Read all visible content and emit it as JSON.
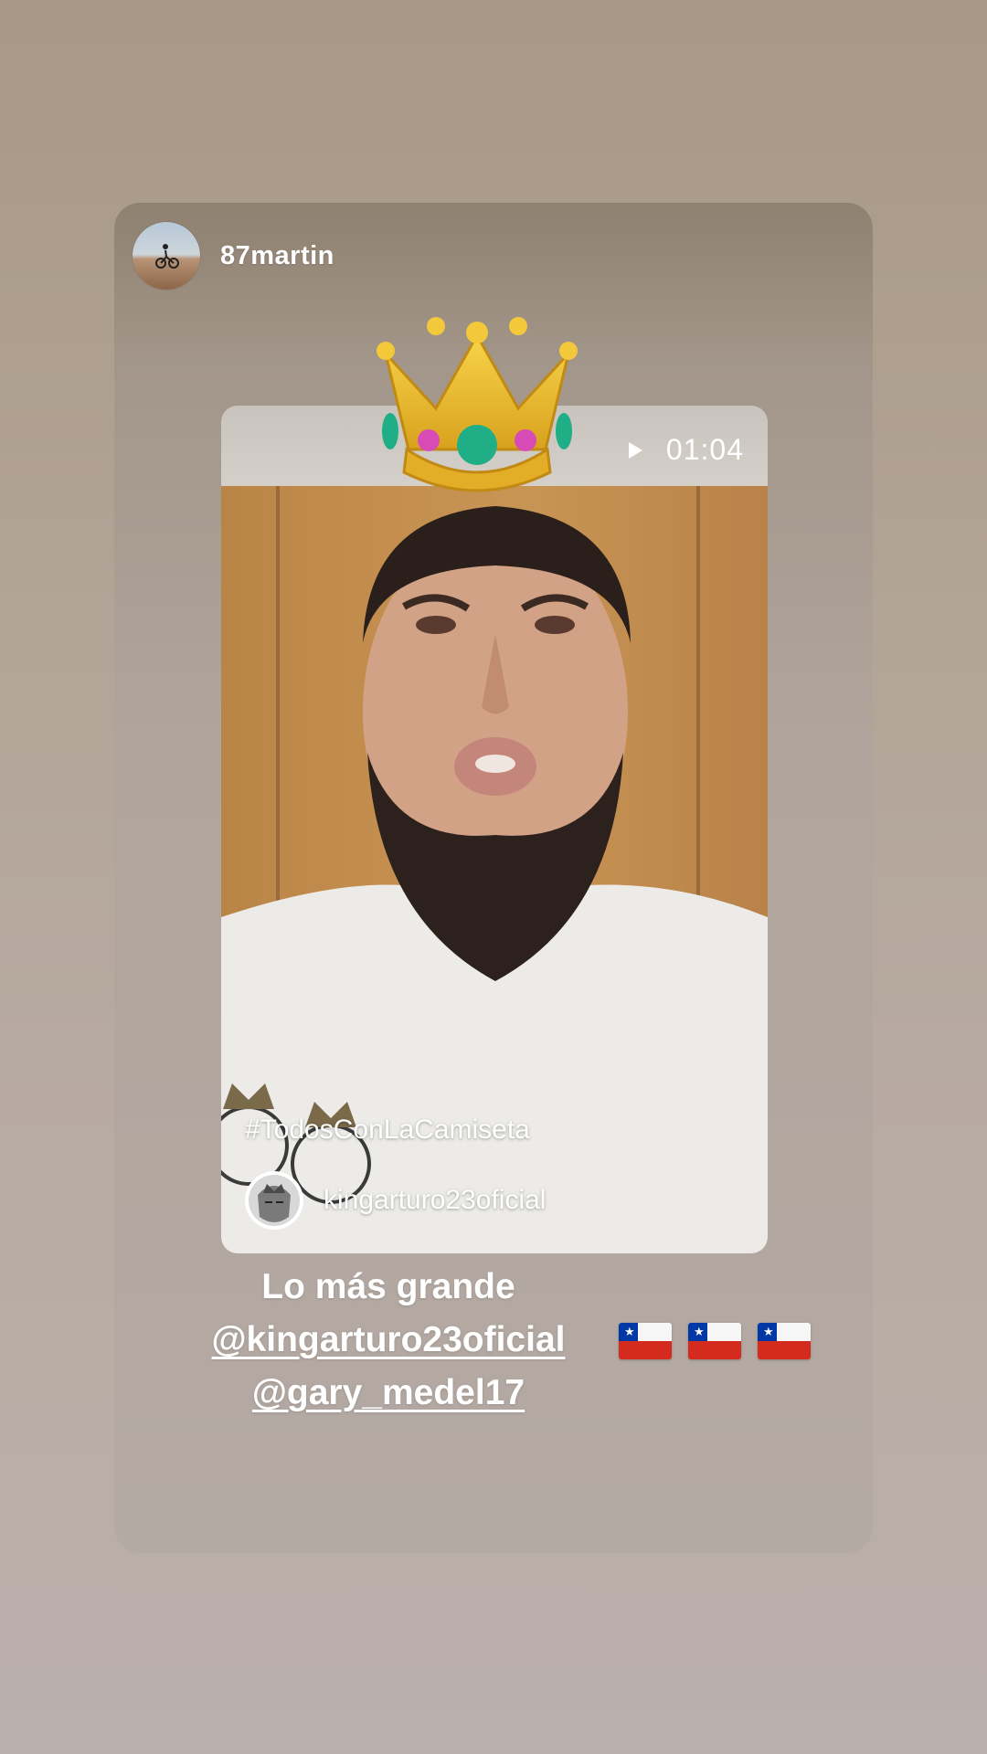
{
  "story": {
    "username": "87martin",
    "avatar_icon": "profile-avatar-cyclist"
  },
  "shared_video": {
    "duration": "01:04",
    "play_icon": "play-icon",
    "hashtag": "#TodosConLaCamiseta",
    "author": "kingarturo23oficial"
  },
  "sticker": {
    "emoji": "crown-icon"
  },
  "caption": {
    "line1": "Lo más grande",
    "mention1": "@kingarturo23oficial",
    "mention2": "@gary_medel17"
  },
  "flags": [
    "chile-flag-icon",
    "chile-flag-icon",
    "chile-flag-icon"
  ],
  "colors": {
    "background_top": "#a89885",
    "background_bottom": "#bab0ac",
    "flag_red": "#d52b1e",
    "flag_blue": "#0039a6",
    "crown_gold": "#e9b92c"
  }
}
